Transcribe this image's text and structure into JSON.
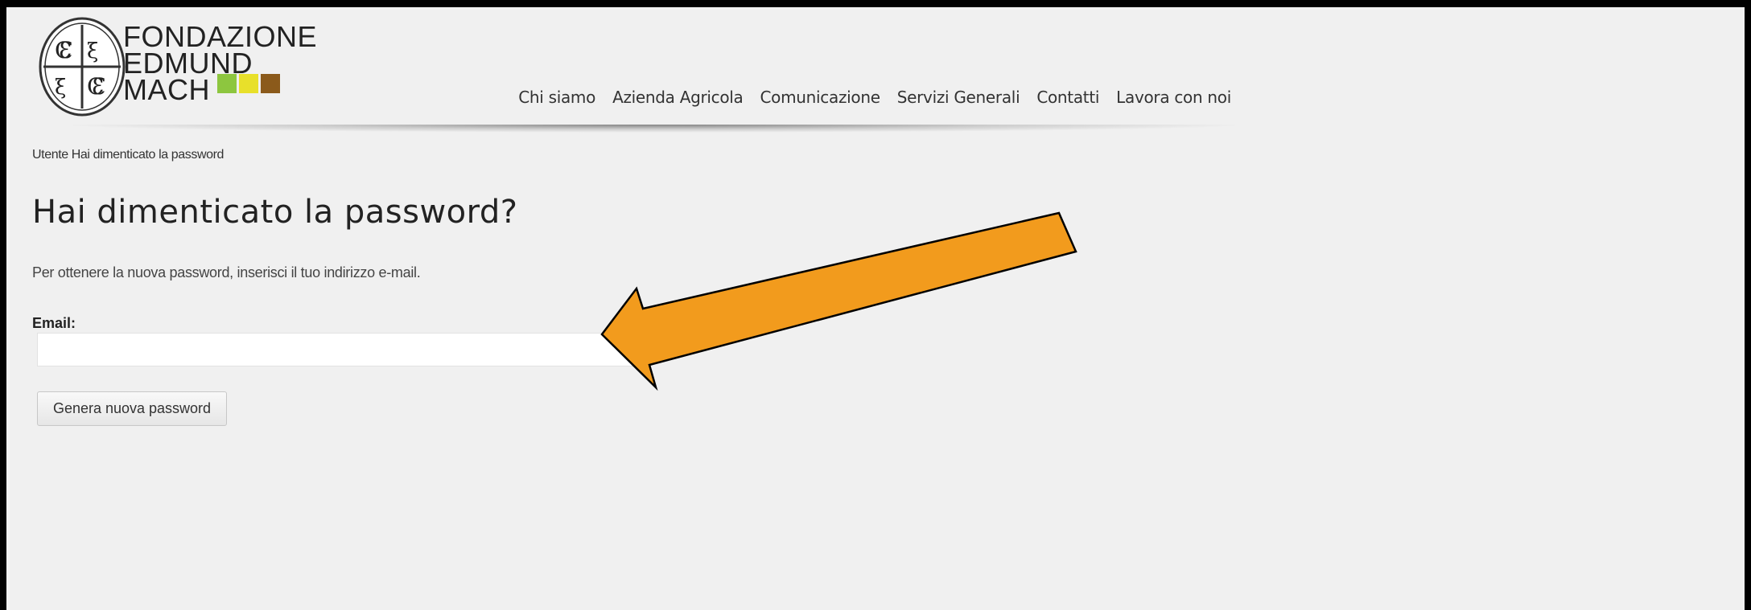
{
  "header": {
    "brand_lines": [
      "FONDAZIONE",
      "EDMUND",
      "MACH"
    ],
    "brand_colors": [
      "#8dc63f",
      "#e8e02a",
      "#8b5a1b"
    ]
  },
  "nav": {
    "items": [
      "Chi siamo",
      "Azienda Agricola",
      "Comunicazione",
      "Servizi Generali",
      "Contatti",
      "Lavora con noi"
    ]
  },
  "breadcrumb": [
    "Utente",
    "Hai dimenticato la password"
  ],
  "main": {
    "title": "Hai dimenticato la password?",
    "description": "Per ottenere la nuova password, inserisci il tuo indirizzo e-mail.",
    "email_label": "Email:",
    "email_value": "",
    "submit_label": "Genera nuova password"
  },
  "annotation": {
    "arrow_color": "#f29b1d",
    "arrow_icon": "arrow-pointing-to-email-field"
  }
}
